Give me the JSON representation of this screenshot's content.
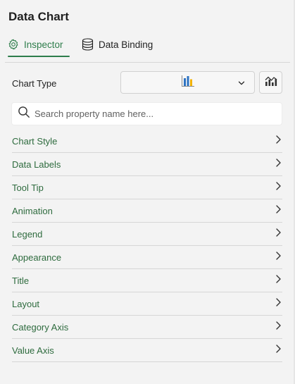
{
  "panel": {
    "title": "Data Chart"
  },
  "tabs": [
    {
      "label": "Inspector",
      "icon": "gear-icon",
      "active": true
    },
    {
      "label": "Data Binding",
      "icon": "database-icon",
      "active": false
    }
  ],
  "chart_type": {
    "label": "Chart Type",
    "selected_icon": "bar-chart-icon",
    "button_icon": "combo-chart-icon"
  },
  "search": {
    "placeholder": "Search property name here..."
  },
  "properties": [
    {
      "label": "Chart Style"
    },
    {
      "label": "Data Labels"
    },
    {
      "label": "Tool Tip"
    },
    {
      "label": "Animation"
    },
    {
      "label": "Legend"
    },
    {
      "label": "Appearance"
    },
    {
      "label": "Title"
    },
    {
      "label": "Layout"
    },
    {
      "label": "Category Axis"
    },
    {
      "label": "Value Axis"
    }
  ],
  "colors": {
    "accent": "#2e7d4b",
    "property_label": "#2e6b3e",
    "background": "#f3f3f3"
  }
}
